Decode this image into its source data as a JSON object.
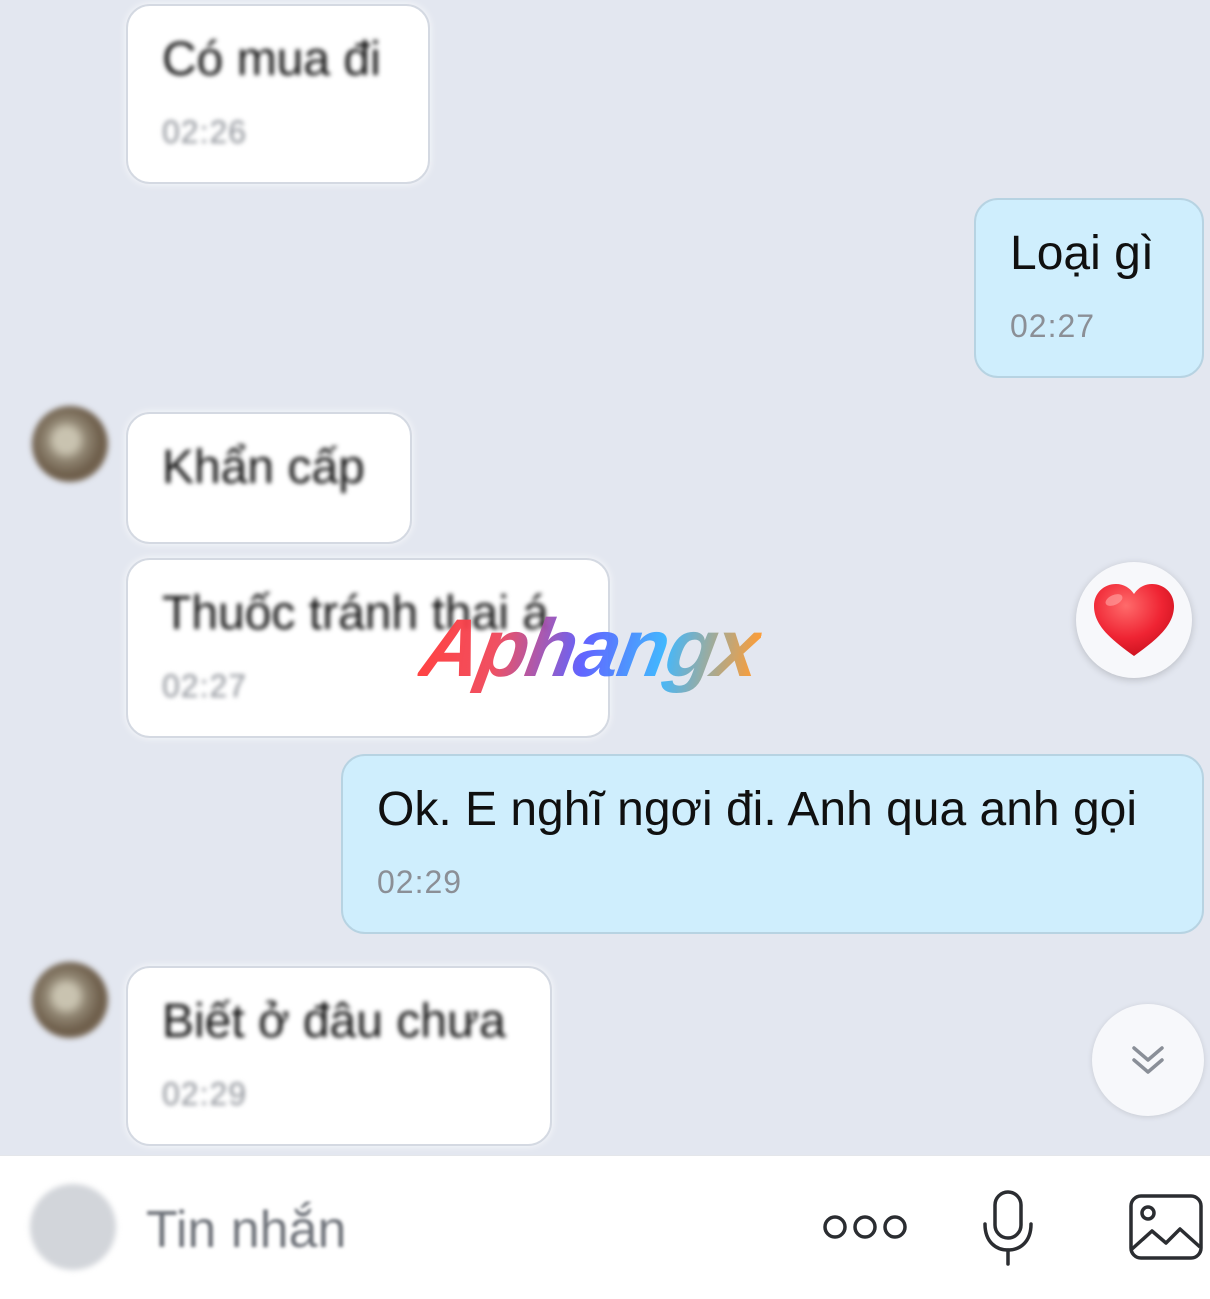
{
  "messages": [
    {
      "text": "Có mua đi",
      "time": "02:26",
      "direction": "incoming"
    },
    {
      "text": "Loại gì",
      "time": "02:27",
      "direction": "outgoing"
    },
    {
      "text": "Khẩn cấp",
      "time": "",
      "direction": "incoming"
    },
    {
      "text": "Thuốc tránh thai á",
      "time": "02:27",
      "direction": "incoming",
      "reaction": "heart"
    },
    {
      "text": "Ok. E nghĩ ngơi đi. Anh qua anh gọi",
      "time": "02:29",
      "direction": "outgoing"
    },
    {
      "text": "Biết ở đâu chưa",
      "time": "02:29",
      "direction": "incoming"
    }
  ],
  "watermark": "Aphangx",
  "composer": {
    "placeholder": "Tin nhắn",
    "icons": [
      "emoji-icon",
      "more-dots-icon",
      "microphone-icon",
      "image-icon"
    ]
  },
  "colors": {
    "background": "#e3e7f0",
    "outgoing_bubble": "#cfeefd",
    "incoming_bubble": "#ffffff",
    "reaction_heart": "#e8242f"
  }
}
